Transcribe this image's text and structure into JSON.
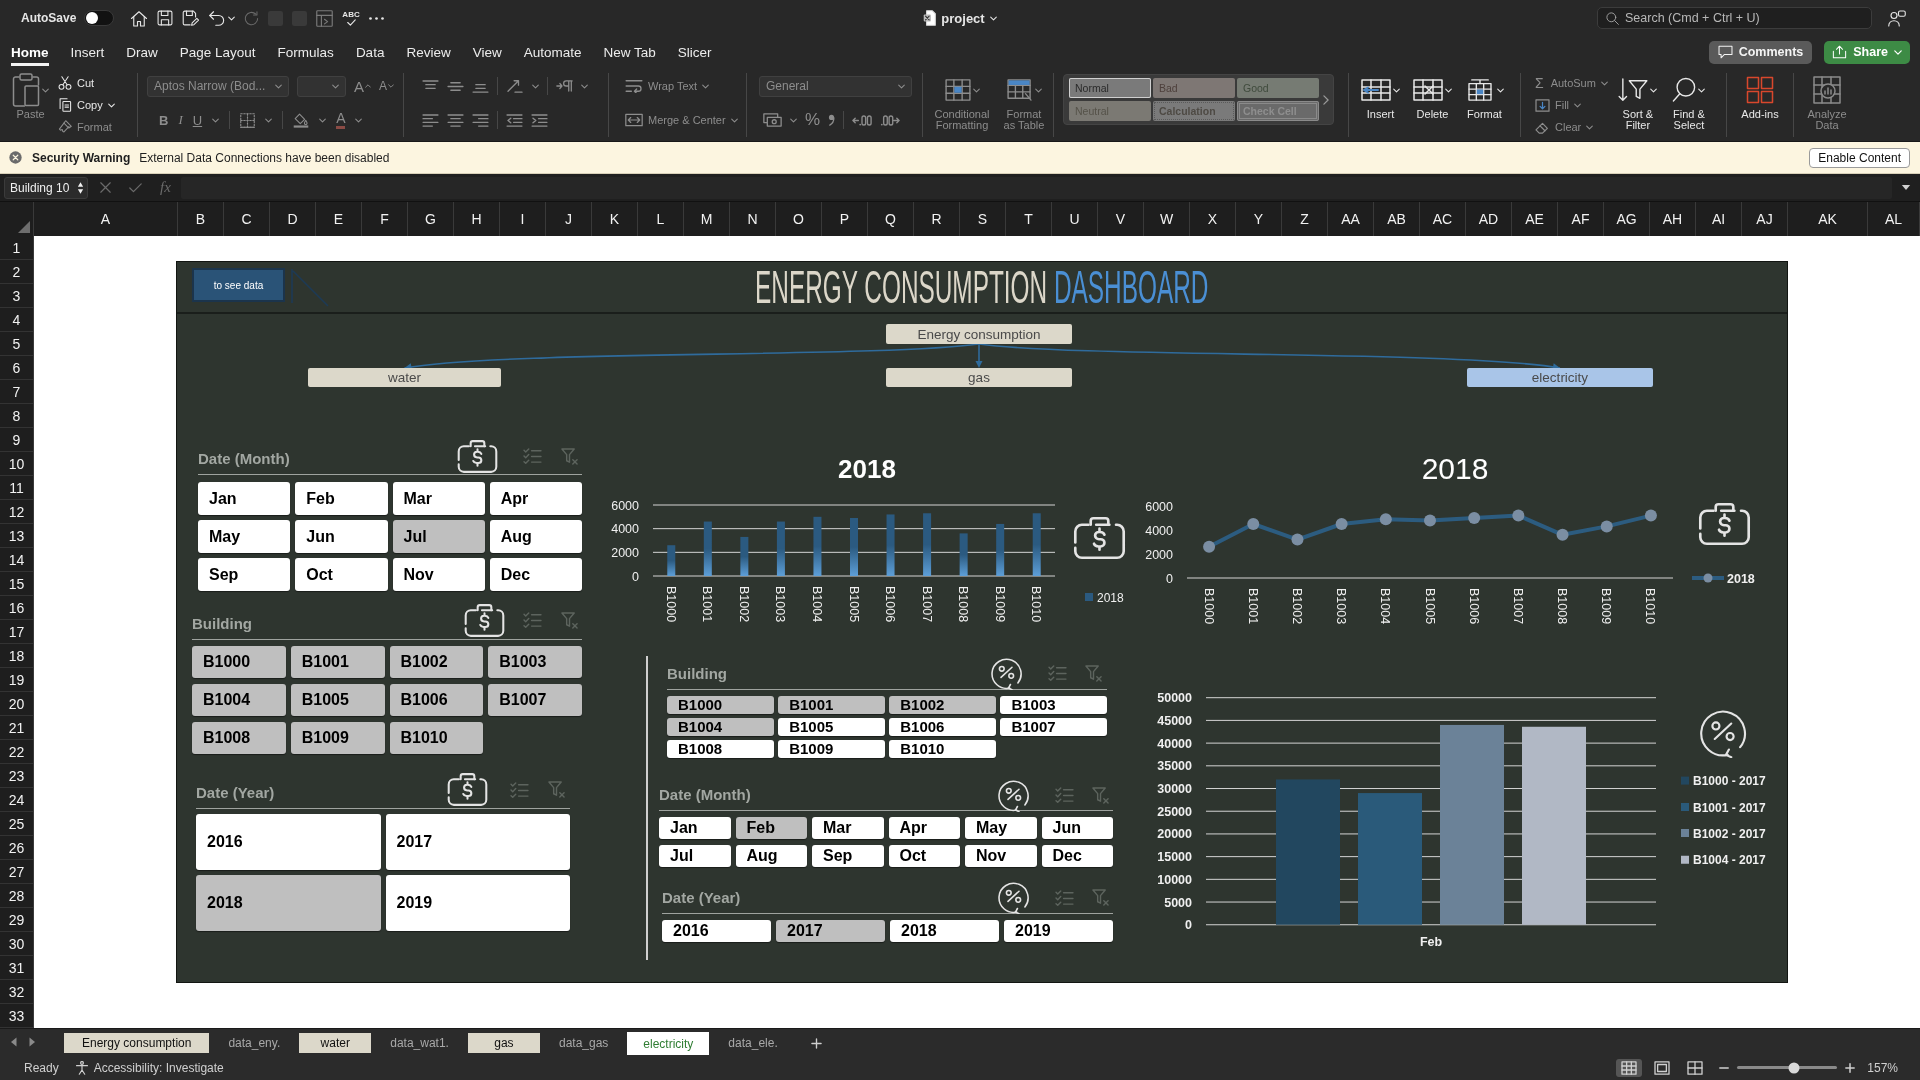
{
  "title_bar": {
    "autosave": {
      "label": "AutoSave",
      "on": false
    },
    "spelling": "ABC",
    "document_title": "project",
    "search": {
      "placeholder": "Search (Cmd + Ctrl + U)"
    }
  },
  "ribbon_tabs": [
    {
      "label": "Home",
      "selected": true
    },
    {
      "label": "Insert",
      "selected": false
    },
    {
      "label": "Draw",
      "selected": false
    },
    {
      "label": "Page Layout",
      "selected": false
    },
    {
      "label": "Formulas",
      "selected": false
    },
    {
      "label": "Data",
      "selected": false
    },
    {
      "label": "Review",
      "selected": false
    },
    {
      "label": "View",
      "selected": false
    },
    {
      "label": "Automate",
      "selected": false
    },
    {
      "label": "New Tab",
      "selected": false
    },
    {
      "label": "Slicer",
      "selected": false
    }
  ],
  "header_buttons": {
    "comments": "Comments",
    "share": "Share"
  },
  "ribbon": {
    "clipboard": [
      {
        "label": "Paste",
        "disabled": true
      },
      {
        "label": "Cut",
        "disabled": false
      },
      {
        "label": "Copy",
        "disabled": false
      },
      {
        "label": "Format",
        "disabled": true
      }
    ],
    "font": {
      "name": "Aptos Narrow (Bod...",
      "grow": "A",
      "shrink": "A",
      "bold": "B",
      "italic": "I",
      "underline": "U",
      "text_color_button": "A",
      "disabled": true
    },
    "alignment": {
      "disabled": true
    },
    "wrap_merge": [
      {
        "label": "Wrap Text",
        "disabled": true
      },
      {
        "label": "Merge & Center",
        "disabled": true
      }
    ],
    "number": {
      "format": "General",
      "percent": "%",
      "disabled": true
    },
    "styles": [
      {
        "label": "Conditional Formatting",
        "disabled": true
      },
      {
        "label": "Format as Table",
        "disabled": true
      }
    ],
    "cell_styles": [
      {
        "label": "Normal",
        "kind": "normal",
        "selected": true
      },
      {
        "label": "Bad",
        "kind": "bad",
        "selected": false
      },
      {
        "label": "Good",
        "kind": "good",
        "selected": false
      },
      {
        "label": "Neutral",
        "kind": "neutral",
        "selected": false
      },
      {
        "label": "Calculation",
        "kind": "calculation",
        "selected": false
      },
      {
        "label": "Check Cell",
        "kind": "check",
        "selected": false
      }
    ],
    "cells": [
      {
        "label": "Insert",
        "disabled": false
      },
      {
        "label": "Delete",
        "disabled": false
      },
      {
        "label": "Format",
        "disabled": false
      }
    ],
    "editing": {
      "sum_symbol": "Σ",
      "items": [
        {
          "label": "AutoSum",
          "disabled": true
        },
        {
          "label": "Fill",
          "disabled": true
        },
        {
          "label": "Clear",
          "disabled": true
        }
      ]
    },
    "sort_find": [
      {
        "label": "Sort & Filter",
        "disabled": false
      },
      {
        "label": "Find & Select",
        "disabled": false
      }
    ],
    "add_ins": [
      {
        "label": "Add-ins",
        "disabled": false
      },
      {
        "label": "Analyze Data",
        "disabled": true
      }
    ]
  },
  "security_warning": {
    "title": "Security Warning",
    "message": "External Data Connections have been disabled",
    "button": "Enable Content"
  },
  "formula_bar": {
    "name_box": "Building 10",
    "function_label": "fx"
  },
  "sheet": {
    "columns": [
      "A",
      "B",
      "C",
      "D",
      "E",
      "F",
      "G",
      "H",
      "I",
      "J",
      "K",
      "L",
      "M",
      "N",
      "O",
      "P",
      "Q",
      "R",
      "S",
      "T",
      "U",
      "V",
      "W",
      "X",
      "Y",
      "Z",
      "AA",
      "AB",
      "AC",
      "AD",
      "AE",
      "AF",
      "AG",
      "AH",
      "AI",
      "AJ",
      "AK",
      "AL"
    ],
    "rows": [
      "1",
      "2",
      "3",
      "4",
      "5",
      "6",
      "7",
      "8",
      "9",
      "10",
      "11",
      "12",
      "13",
      "14",
      "15",
      "16",
      "17",
      "18",
      "19",
      "20",
      "21",
      "22",
      "23",
      "24",
      "25",
      "26",
      "27",
      "28",
      "29",
      "30",
      "31",
      "32",
      "33"
    ]
  },
  "dashboard": {
    "link_button": "to see data",
    "title": {
      "text": "ENERGY CONSUMPTION",
      "accent": "DASHBOARD"
    },
    "diagram": {
      "root": "Energy consumption",
      "branches": [
        {
          "label": "water",
          "selected": false
        },
        {
          "label": "gas",
          "selected": false
        },
        {
          "label": "electricity",
          "selected": true
        }
      ]
    },
    "left_slicers": [
      {
        "title": "Date (Month)",
        "items": [
          {
            "label": "Jan",
            "selected": false
          },
          {
            "label": "Feb",
            "selected": false
          },
          {
            "label": "Mar",
            "selected": false
          },
          {
            "label": "Apr",
            "selected": false
          },
          {
            "label": "May",
            "selected": false
          },
          {
            "label": "Jun",
            "selected": false
          },
          {
            "label": "Jul",
            "selected": true
          },
          {
            "label": "Aug",
            "selected": false
          },
          {
            "label": "Sep",
            "selected": false
          },
          {
            "label": "Oct",
            "selected": false
          },
          {
            "label": "Nov",
            "selected": false
          },
          {
            "label": "Dec",
            "selected": false
          }
        ]
      },
      {
        "title": "Building",
        "items": [
          {
            "label": "B1000",
            "selected": true
          },
          {
            "label": "B1001",
            "selected": true
          },
          {
            "label": "B1002",
            "selected": true
          },
          {
            "label": "B1003",
            "selected": true
          },
          {
            "label": "B1004",
            "selected": true
          },
          {
            "label": "B1005",
            "selected": true
          },
          {
            "label": "B1006",
            "selected": true
          },
          {
            "label": "B1007",
            "selected": true
          },
          {
            "label": "B1008",
            "selected": true
          },
          {
            "label": "B1009",
            "selected": true
          },
          {
            "label": "B1010",
            "selected": true
          }
        ]
      },
      {
        "title": "Date (Year)",
        "items": [
          {
            "label": "2016",
            "selected": false
          },
          {
            "label": "2017",
            "selected": false
          },
          {
            "label": "2018",
            "selected": true
          },
          {
            "label": "2019",
            "selected": false
          }
        ]
      }
    ],
    "bar_chart": {
      "chart_data": {
        "type": "bar",
        "title": "2018",
        "categories": [
          "B1000",
          "B1001",
          "B1002",
          "B1003",
          "B1004",
          "B1005",
          "B1006",
          "B1007",
          "B1008",
          "B1009",
          "B1010"
        ],
        "series": [
          {
            "name": "2018",
            "color": "#2b5a80",
            "values": [
              2600,
              4600,
              3300,
              4600,
              5000,
              4900,
              5200,
              5300,
              3600,
              4400,
              5300
            ]
          }
        ],
        "ylim": [
          0,
          6000
        ],
        "yticks": [
          0,
          2000,
          4000,
          6000
        ],
        "grid": true,
        "legend": "right"
      }
    },
    "line_chart": {
      "chart_data": {
        "type": "line",
        "title": "2018",
        "categories": [
          "B1000",
          "B1001",
          "B1002",
          "B1003",
          "B1004",
          "B1005",
          "B1006",
          "B1007",
          "B1008",
          "B1009",
          "B1010"
        ],
        "series": [
          {
            "name": "2018",
            "color": "#2c5c80",
            "values": [
              2600,
              4500,
              3200,
              4500,
              4900,
              4800,
              5000,
              5200,
              3600,
              4300,
              5200
            ]
          }
        ],
        "ylim": [
          0,
          6000
        ],
        "yticks": [
          0,
          2000,
          4000,
          6000
        ],
        "marker": "circle",
        "legend": "right"
      }
    },
    "right_slicers": [
      {
        "title": "Building",
        "items": [
          {
            "label": "B1000",
            "selected": true
          },
          {
            "label": "B1001",
            "selected": true
          },
          {
            "label": "B1002",
            "selected": true
          },
          {
            "label": "B1003",
            "selected": false
          },
          {
            "label": "B1004",
            "selected": true
          },
          {
            "label": "B1005",
            "selected": false
          },
          {
            "label": "B1006",
            "selected": false
          },
          {
            "label": "B1007",
            "selected": false
          },
          {
            "label": "B1008",
            "selected": false
          },
          {
            "label": "B1009",
            "selected": false
          },
          {
            "label": "B1010",
            "selected": false
          }
        ]
      },
      {
        "title": "Date (Month)",
        "items": [
          {
            "label": "Jan",
            "selected": false
          },
          {
            "label": "Feb",
            "selected": true
          },
          {
            "label": "Mar",
            "selected": false
          },
          {
            "label": "Apr",
            "selected": false
          },
          {
            "label": "May",
            "selected": false
          },
          {
            "label": "Jun",
            "selected": false
          },
          {
            "label": "Jul",
            "selected": false
          },
          {
            "label": "Aug",
            "selected": false
          },
          {
            "label": "Sep",
            "selected": false
          },
          {
            "label": "Oct",
            "selected": false
          },
          {
            "label": "Nov",
            "selected": false
          },
          {
            "label": "Dec",
            "selected": false
          }
        ]
      },
      {
        "title": "Date (Year)",
        "items": [
          {
            "label": "2016",
            "selected": false
          },
          {
            "label": "2017",
            "selected": true
          },
          {
            "label": "2018",
            "selected": false
          },
          {
            "label": "2019",
            "selected": false
          }
        ]
      }
    ],
    "comparison_chart": {
      "chart_data": {
        "type": "bar",
        "categories": [
          "Feb"
        ],
        "series": [
          {
            "name": "B1000 - 2017",
            "color": "#22475f",
            "values": [
              32000
            ]
          },
          {
            "name": "B1001 - 2017",
            "color": "#2a5a7a",
            "values": [
              29000
            ]
          },
          {
            "name": "B1002 - 2017",
            "color": "#6b8298",
            "values": [
              44000
            ]
          },
          {
            "name": "B1004 - 2017",
            "color": "#b1b8c5",
            "values": [
              43600
            ]
          }
        ],
        "ylim": [
          0,
          50000
        ],
        "yticks": [
          0,
          5000,
          10000,
          15000,
          20000,
          25000,
          30000,
          35000,
          40000,
          45000,
          50000
        ],
        "grid": true,
        "legend": "right"
      }
    }
  },
  "sheet_tabs": [
    {
      "label": "Energy consumption",
      "selected": false,
      "color": "#dcd8ca"
    },
    {
      "label": "data_eny.",
      "selected": false
    },
    {
      "label": "water",
      "selected": false,
      "color": "#dcd8ca"
    },
    {
      "label": "data_wat1.",
      "selected": false
    },
    {
      "label": "gas",
      "selected": false,
      "color": "#dcd8ca"
    },
    {
      "label": "data_gas",
      "selected": false
    },
    {
      "label": "electricity",
      "selected": true
    },
    {
      "label": "data_ele.",
      "selected": false
    }
  ],
  "status_bar": {
    "status": "Ready",
    "accessibility": "Accessibility: Investigate",
    "view_modes": [
      {
        "selected": true
      },
      {
        "selected": false
      },
      {
        "selected": false
      }
    ],
    "zoom": {
      "level": 0.57,
      "reading": "157%"
    }
  }
}
